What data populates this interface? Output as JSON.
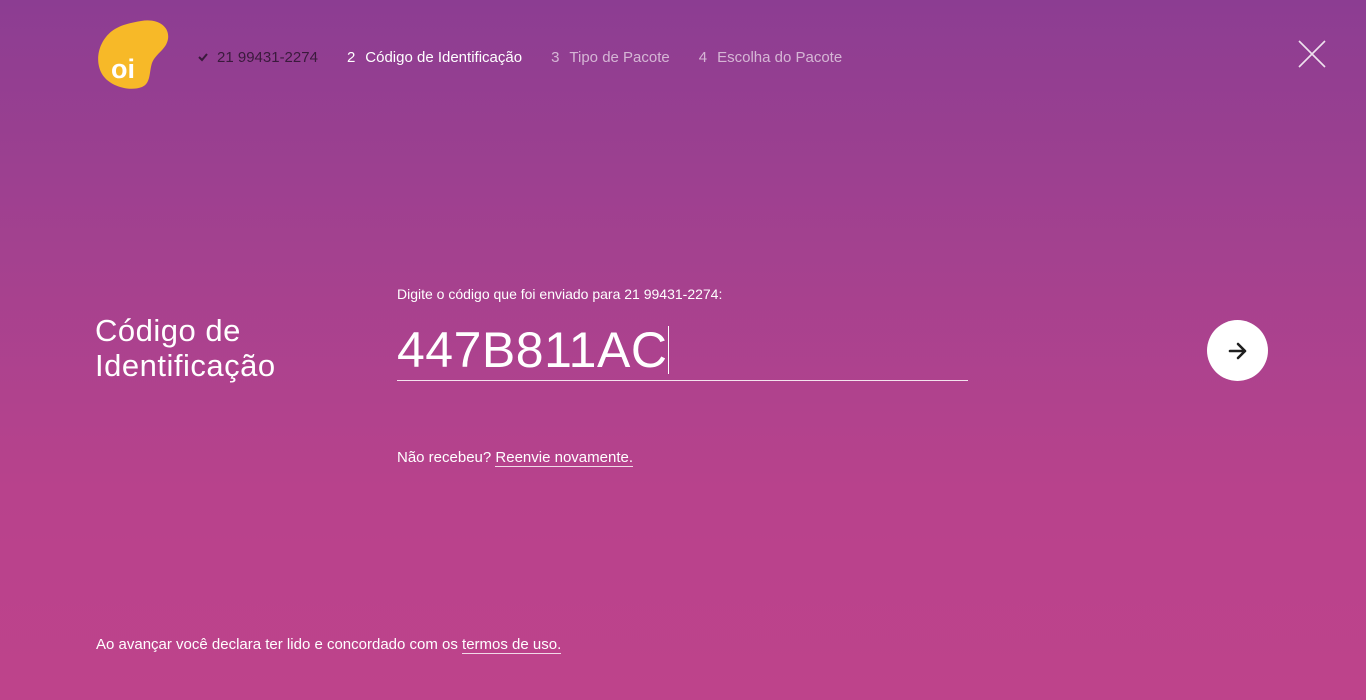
{
  "brand": {
    "logo_text": "oi",
    "logo_color": "#f7b928"
  },
  "stepper": {
    "steps": [
      {
        "status": "done",
        "label": "21 99431-2274"
      },
      {
        "status": "active",
        "number": "2",
        "label": "Código de Identificação"
      },
      {
        "status": "pending",
        "number": "3",
        "label": "Tipo de Pacote"
      },
      {
        "status": "pending",
        "number": "4",
        "label": "Escolha do Pacote"
      }
    ]
  },
  "header": {
    "close_icon": "close-icon"
  },
  "main": {
    "title": "Código de Identificação",
    "prompt": "Digite o código que foi enviado para 21 99431-2274:",
    "code_value": "447B811AC",
    "next_icon": "arrow-right-icon",
    "resend_text": "Não recebeu? ",
    "resend_link": "Reenvie novamente."
  },
  "footer": {
    "terms_text": "Ao avançar você declara ter lido e concordado com os ",
    "terms_link": "termos de uso."
  },
  "colors": {
    "background_top": "#8c3d92",
    "background_bottom": "#be438b",
    "accent": "#f7b928",
    "text": "#ffffff"
  }
}
